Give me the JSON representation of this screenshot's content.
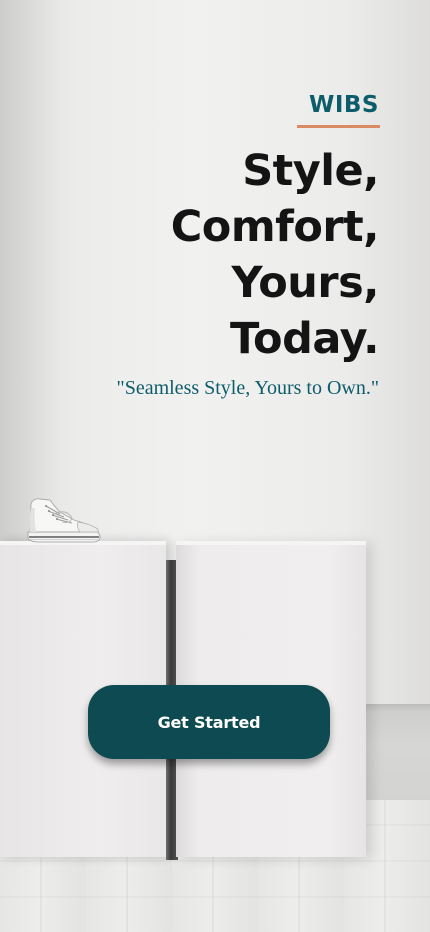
{
  "brand": {
    "name": "WIBS",
    "color": "#0d5c6b",
    "underline_color": "#d98c63"
  },
  "hero": {
    "headline_lines": [
      "Style,",
      "Comfort,",
      "Yours,",
      "Today."
    ],
    "tagline": "\"Seamless Style, Yours to Own.\""
  },
  "cta": {
    "label": "Get Started",
    "background": "#0d4a51"
  },
  "icons": {
    "sneaker": "sneaker-icon"
  }
}
